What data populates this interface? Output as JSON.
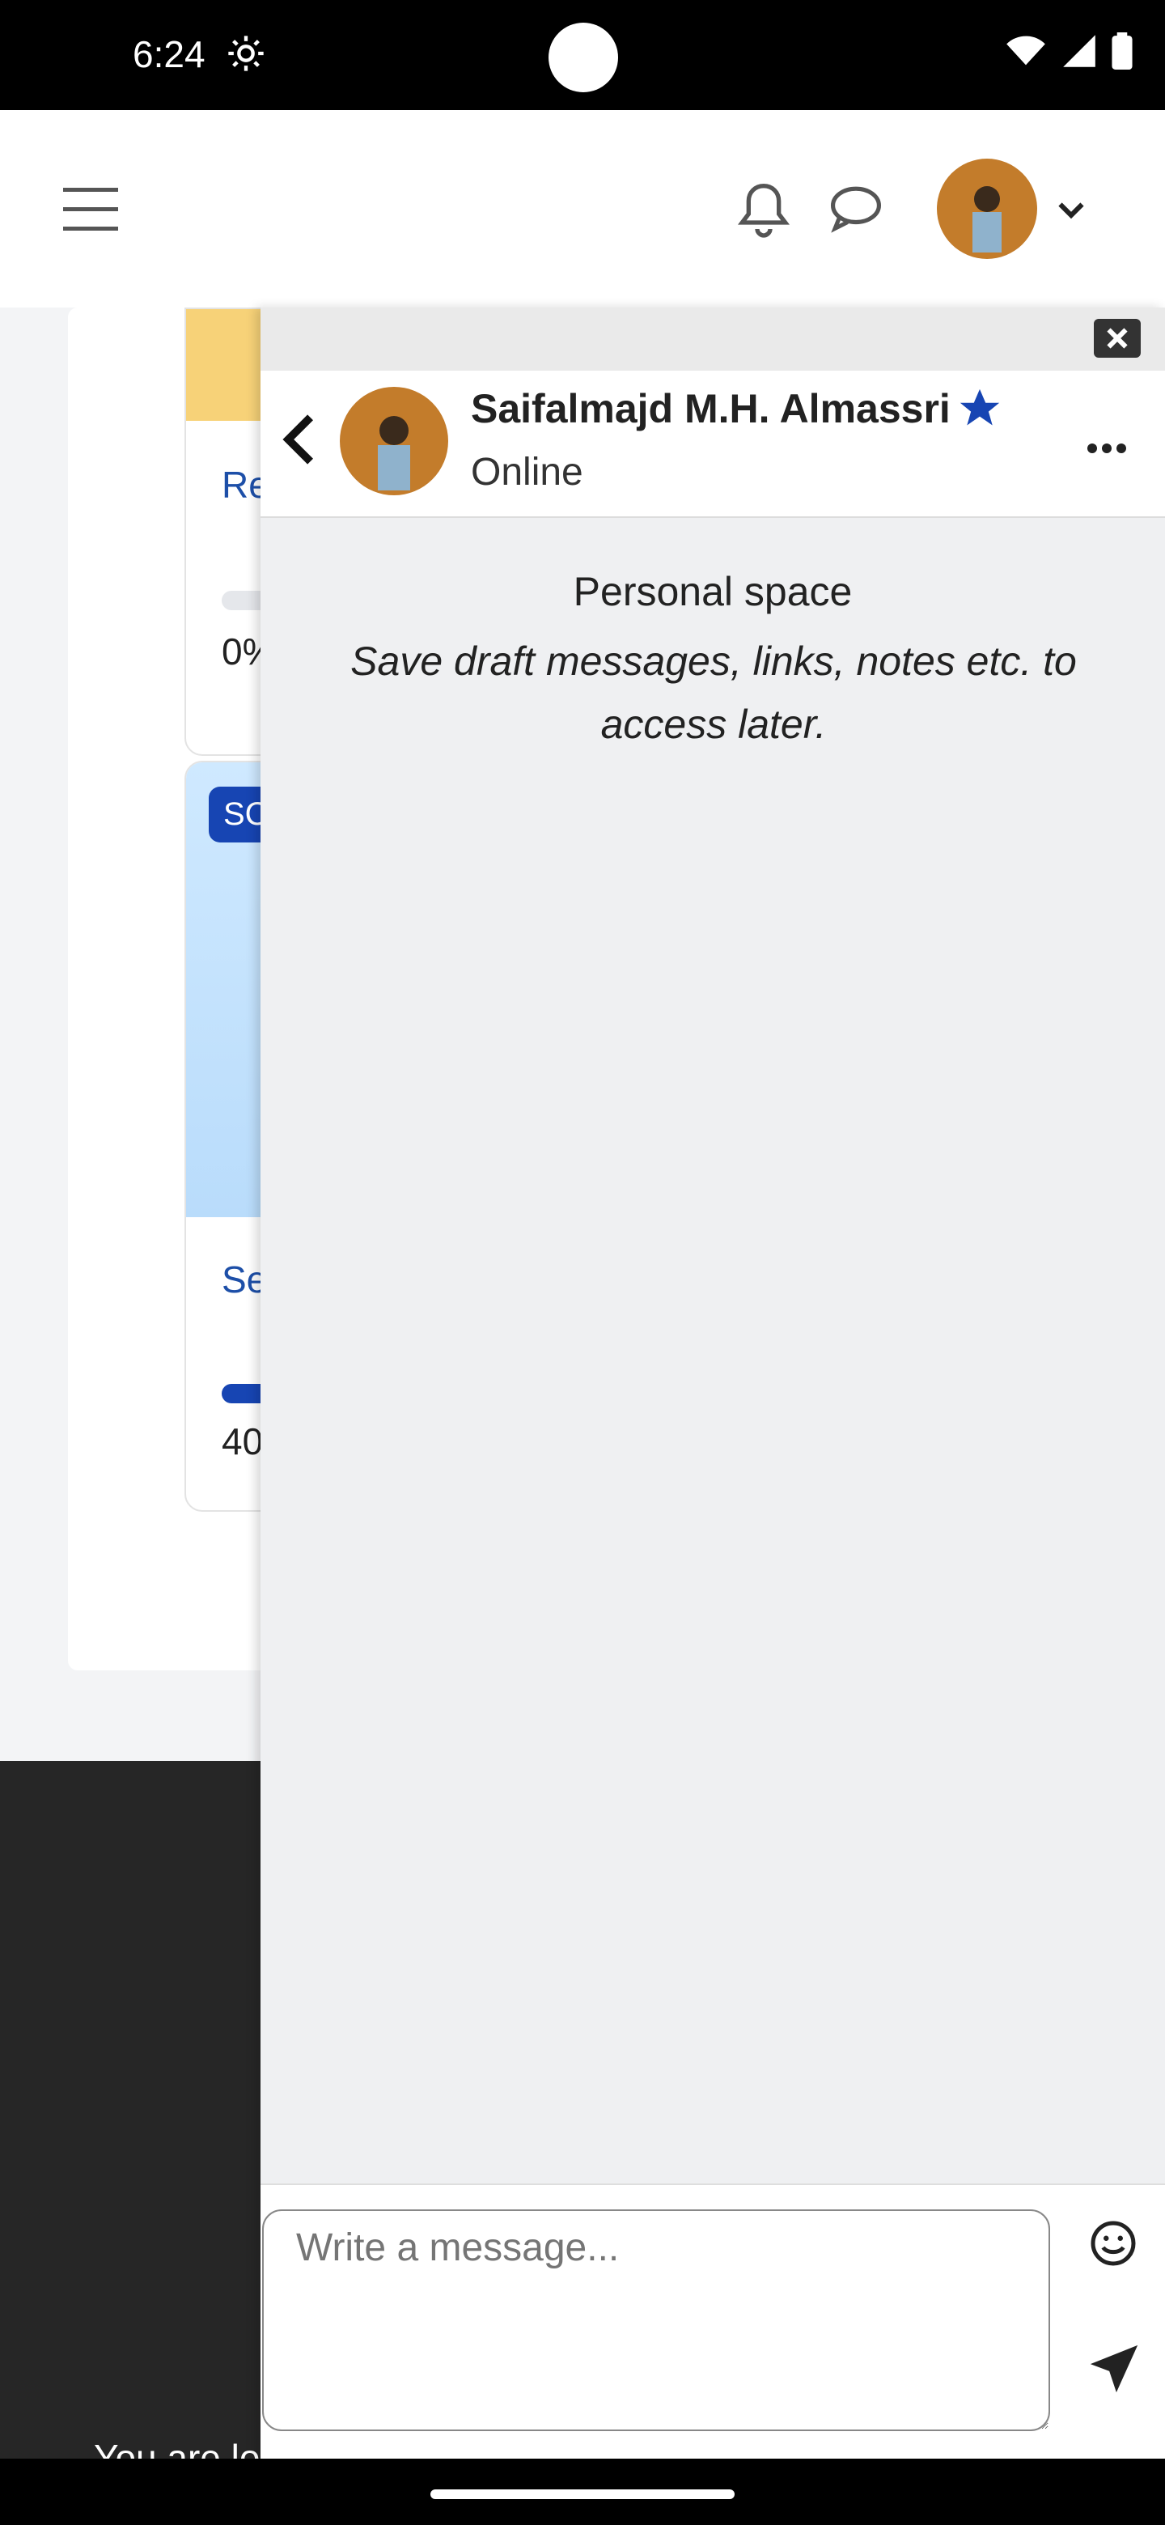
{
  "status_bar": {
    "time": "6:24"
  },
  "top_nav": {
    "avatar_colors": {
      "bg": "#c37c2b"
    }
  },
  "courses": {
    "card1": {
      "title": "Re",
      "percent": "0%"
    },
    "card2": {
      "badge": "SC",
      "title": "Se",
      "percent": "40"
    }
  },
  "chat": {
    "name": "Saifalmajd M.H. Almassri",
    "status": "Online",
    "personal_title": "Personal space",
    "personal_desc": "Save draft messages, links, notes etc. to access later.",
    "input_placeholder": "Write a message..."
  },
  "footer": {
    "text": "You are lo"
  },
  "colors": {
    "accent": "#1745b3",
    "link": "#1d4fa8"
  }
}
